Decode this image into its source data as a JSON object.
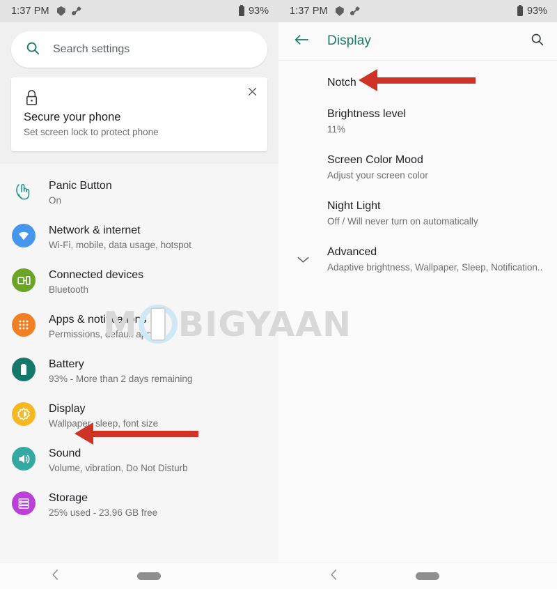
{
  "statusbar": {
    "time": "1:37 PM",
    "battery_percent": "93%",
    "icons": [
      "shield-icon",
      "usb-debug-icon",
      "battery-icon"
    ]
  },
  "left_panel": {
    "search": {
      "placeholder": "Search settings",
      "icon": "search-icon"
    },
    "promo_card": {
      "icon": "lock-icon",
      "close_icon": "close-icon",
      "title": "Secure your phone",
      "subtitle": "Set screen lock to protect phone"
    },
    "items": [
      {
        "title": "Panic Button",
        "subtitle": "On",
        "icon": "panic-hand-icon",
        "color": "#2e9c8e"
      },
      {
        "title": "Network & internet",
        "subtitle": "Wi-Fi, mobile, data usage, hotspot",
        "icon": "wifi-icon",
        "color": "#4596ec"
      },
      {
        "title": "Connected devices",
        "subtitle": "Bluetooth",
        "icon": "devices-icon",
        "color": "#6aa528"
      },
      {
        "title": "Apps & notifications",
        "subtitle": "Permissions, default apps",
        "icon": "apps-grid-icon",
        "color": "#f08023"
      },
      {
        "title": "Battery",
        "subtitle": "93% - More than 2 days remaining",
        "icon": "battery-icon",
        "color": "#14796b"
      },
      {
        "title": "Display",
        "subtitle": "Wallpaper, sleep, font size",
        "icon": "brightness-icon",
        "color": "#f5b824"
      },
      {
        "title": "Sound",
        "subtitle": "Volume, vibration, Do Not Disturb",
        "icon": "speaker-icon",
        "color": "#34a9a2"
      },
      {
        "title": "Storage",
        "subtitle": "25% used - 23.96 GB free",
        "icon": "storage-icon",
        "color": "#bb40d8"
      }
    ]
  },
  "right_panel": {
    "appbar": {
      "back_icon": "back-arrow-icon",
      "title": "Display",
      "search_icon": "search-icon",
      "title_color": "#1a7a66"
    },
    "items": [
      {
        "title": "Notch",
        "subtitle": "",
        "expandable": false
      },
      {
        "title": "Brightness level",
        "subtitle": "11%",
        "expandable": false
      },
      {
        "title": "Screen Color Mood",
        "subtitle": "Adjust your screen color",
        "expandable": false
      },
      {
        "title": "Night Light",
        "subtitle": "Off / Will never turn on automatically",
        "expandable": false
      },
      {
        "title": "Advanced",
        "subtitle": "Adaptive brightness, Wallpaper, Sleep, Notification..",
        "expandable": true
      }
    ]
  },
  "navbar": {
    "back_icon": "nav-back-icon",
    "home_icon": "nav-home-pill"
  },
  "annotations": {
    "arrow_color": "#cf3326",
    "arrows": [
      "points-to-display-item",
      "points-to-notch-item"
    ]
  },
  "watermark": {
    "text_before": "M",
    "logo": "phone-in-circle-logo",
    "text_after": "BIGYAAN",
    "full_text": "MOBIGYAAN",
    "color": "#d8d8d8"
  }
}
